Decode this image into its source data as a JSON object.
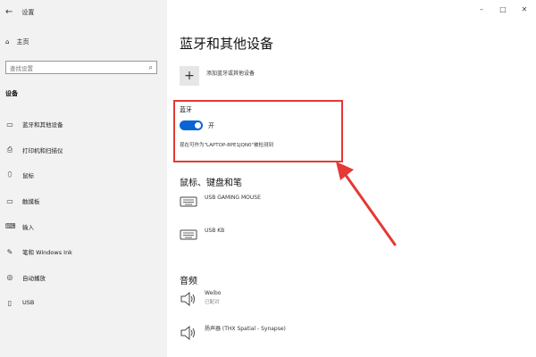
{
  "window": {
    "title": "设置"
  },
  "sidebar": {
    "home": "主页",
    "search_placeholder": "查找设置",
    "section": "设备",
    "items": [
      {
        "icon": "bluetooth-devices-icon",
        "label": "蓝牙和其他设备"
      },
      {
        "icon": "printer-icon",
        "label": "打印机和扫描仪"
      },
      {
        "icon": "mouse-icon",
        "label": "鼠标"
      },
      {
        "icon": "touchpad-icon",
        "label": "触摸板"
      },
      {
        "icon": "keyboard-icon",
        "label": "输入"
      },
      {
        "icon": "pen-icon",
        "label": "笔和 Windows Ink"
      },
      {
        "icon": "autoplay-icon",
        "label": "自动播放"
      },
      {
        "icon": "usb-icon",
        "label": "USB"
      }
    ]
  },
  "main": {
    "title": "蓝牙和其他设备",
    "add_device": "添加蓝牙或其他设备",
    "bluetooth": {
      "title": "蓝牙",
      "toggle_label": "开",
      "toggle_on": true,
      "discoverable_text": "现在可作为\"LAPTOP-8PE1JQN0\"被检测到"
    },
    "mouse_section": {
      "title": "鼠标、键盘和笔",
      "devices": [
        {
          "name": "USB GAMING MOUSE"
        },
        {
          "name": "USB KB"
        }
      ]
    },
    "audio_section": {
      "title": "音频",
      "devices": [
        {
          "name": "Weibo",
          "status": "已配对"
        },
        {
          "name": "扬声器 (THX Spatial - Synapse)"
        }
      ]
    }
  },
  "colors": {
    "accent": "#0a64d6",
    "highlight": "#e53935",
    "sidebar_bg": "#f2f2f2"
  }
}
